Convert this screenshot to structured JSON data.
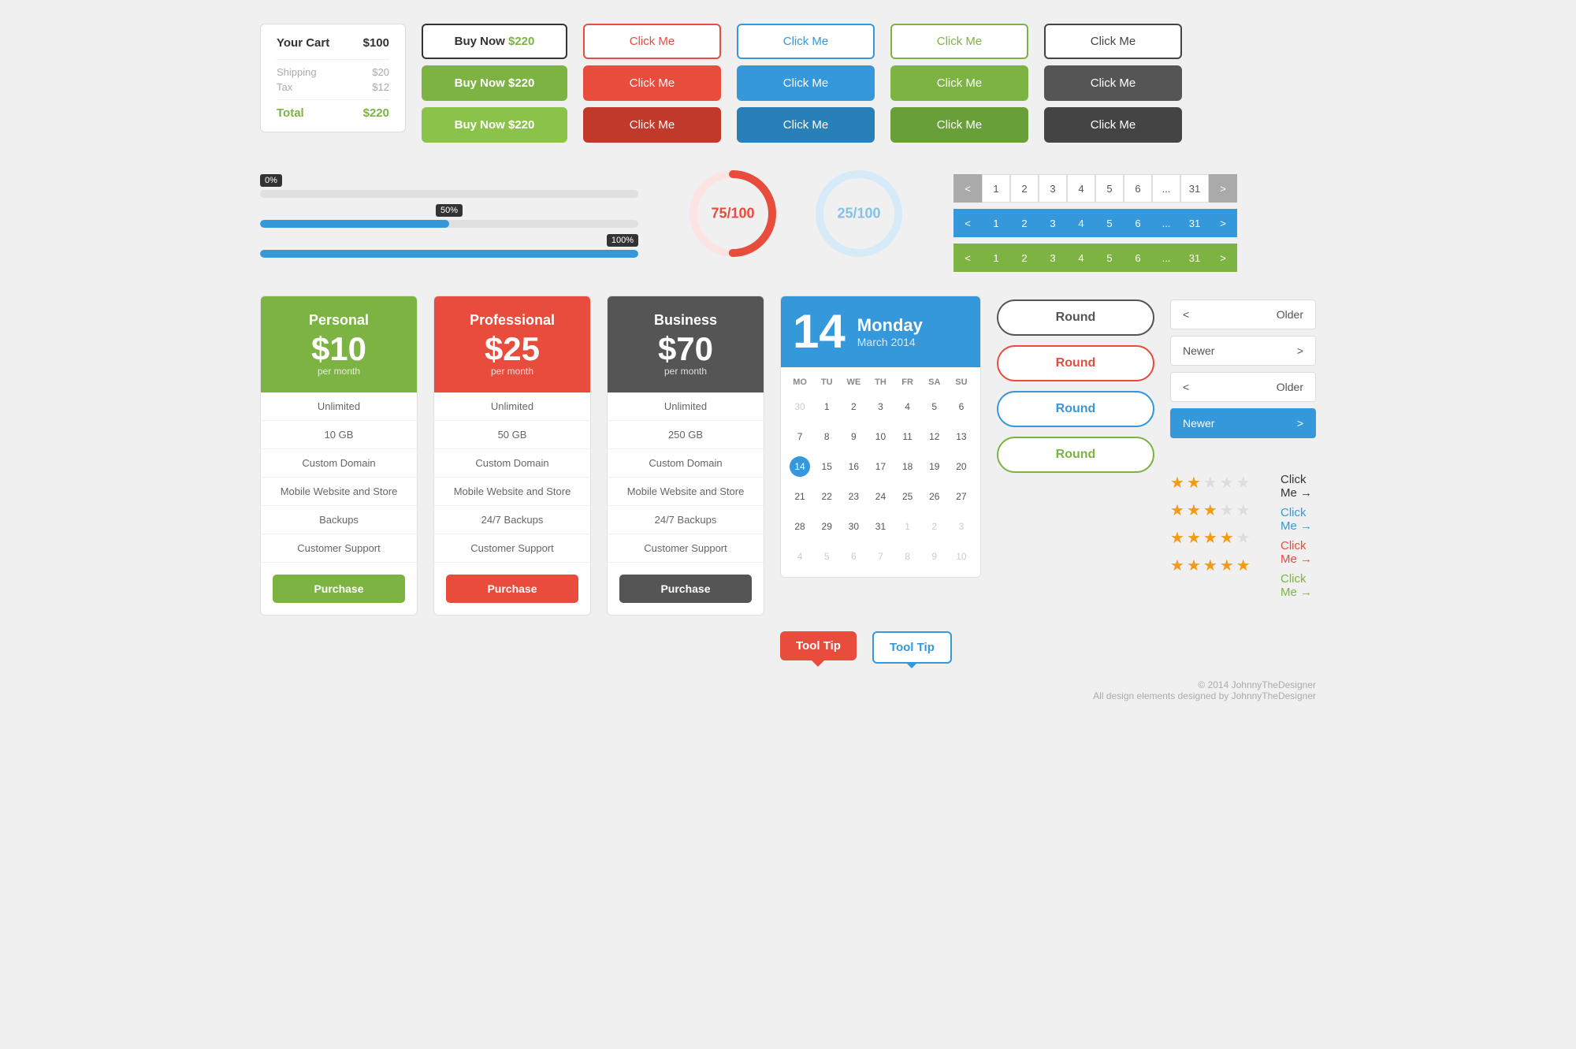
{
  "cart": {
    "title": "Your Cart",
    "total_label": "$100",
    "shipping_label": "Shipping",
    "shipping_val": "$20",
    "tax_label": "Tax",
    "tax_val": "$12",
    "total_text": "Total",
    "grand_total": "$220"
  },
  "buy_now": {
    "outline_label": "Buy Now",
    "outline_price": "$220",
    "green1_label": "Buy Now  $220",
    "green2_label": "Buy Now  $220"
  },
  "buttons": {
    "click_me": "Click Me"
  },
  "progress": {
    "label_0": "0%",
    "label_50": "50%",
    "label_100": "100%"
  },
  "donut1": {
    "label": "75/100"
  },
  "donut2": {
    "label": "25/100"
  },
  "pagination": {
    "items": [
      "1",
      "2",
      "3",
      "4",
      "5",
      "6",
      "...",
      "31"
    ],
    "prev": "<",
    "next": ">"
  },
  "pricing": {
    "personal": {
      "name": "Personal",
      "price": "$10",
      "period": "per month",
      "features": [
        "Unlimited",
        "10 GB",
        "Custom Domain",
        "Mobile Website and Store",
        "Backups",
        "Customer Support"
      ],
      "cta": "Purchase"
    },
    "professional": {
      "name": "Professional",
      "price": "$25",
      "period": "per month",
      "features": [
        "Unlimited",
        "50 GB",
        "Custom Domain",
        "Mobile Website and Store",
        "24/7 Backups",
        "Customer Support"
      ],
      "cta": "Purchase"
    },
    "business": {
      "name": "Business",
      "price": "$70",
      "period": "per month",
      "features": [
        "Unlimited",
        "250 GB",
        "Custom Domain",
        "Mobile Website and Store",
        "24/7 Backups",
        "Customer Support"
      ],
      "cta": "Purchase"
    }
  },
  "calendar": {
    "day_num": "14",
    "day_name": "Monday",
    "month": "March 2014",
    "headers": [
      "MO",
      "TU",
      "WE",
      "TH",
      "FR",
      "SA",
      "SU"
    ],
    "weeks": [
      [
        "30",
        "1",
        "2",
        "3",
        "4",
        "5",
        "6"
      ],
      [
        "7",
        "8",
        "9",
        "10",
        "11",
        "12",
        "13"
      ],
      [
        "14",
        "15",
        "16",
        "17",
        "18",
        "19",
        "20"
      ],
      [
        "21",
        "22",
        "23",
        "24",
        "25",
        "26",
        "27"
      ],
      [
        "28",
        "29",
        "30",
        "31",
        "1",
        "2",
        "3"
      ],
      [
        "4",
        "5",
        "6",
        "7",
        "8",
        "9",
        "10"
      ]
    ]
  },
  "round_buttons": {
    "dark": "Round",
    "red": "Round",
    "blue": "Round",
    "green": "Round"
  },
  "nav_buttons": {
    "older1": "Older",
    "newer1": "Newer",
    "older2": "Older",
    "newer2": "Newer"
  },
  "stars": {
    "rows": [
      2,
      3,
      4,
      5
    ]
  },
  "links": {
    "items": [
      {
        "label": "Click Me →",
        "color": "black"
      },
      {
        "label": "Click Me →",
        "color": "blue"
      },
      {
        "label": "Click Me →",
        "color": "red"
      },
      {
        "label": "Click Me →",
        "color": "green"
      }
    ]
  },
  "tooltips": {
    "tooltip1": "Tool Tip",
    "tooltip2": "Tool Tip"
  },
  "footer": {
    "line1": "© 2014 JohnnyTheDesigner",
    "line2": "All design elements designed by JohnnyTheDesigner"
  }
}
